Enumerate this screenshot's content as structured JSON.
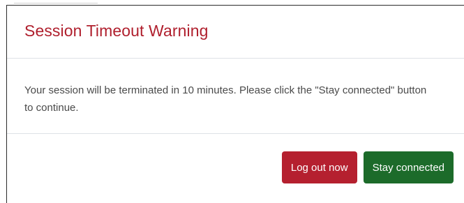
{
  "dialog": {
    "title": "Session Timeout Warning",
    "message": "Your session will be terminated in 10 minutes. Please click the \"Stay connected\" button to continue.",
    "buttons": {
      "logout_label": "Log out now",
      "stay_label": "Stay connected"
    }
  },
  "colors": {
    "title": "#b0202e",
    "logout_button": "#b5202f",
    "stay_button": "#1c6b2a"
  }
}
